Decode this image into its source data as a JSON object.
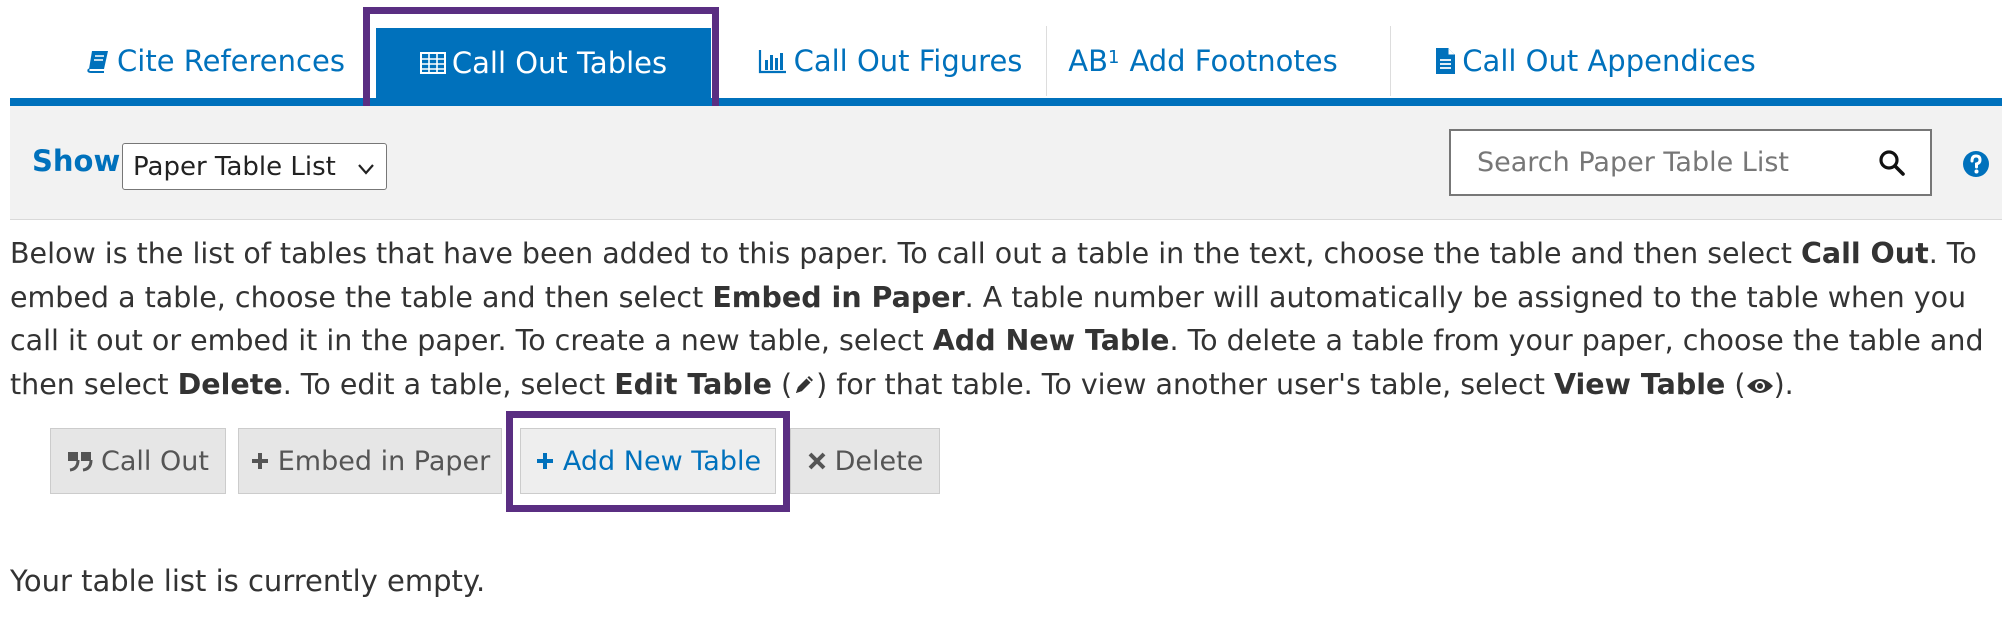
{
  "tabs": [
    {
      "label": "Cite References",
      "icon": "book-icon"
    },
    {
      "label": "Call Out Tables",
      "icon": "table-icon",
      "active": true
    },
    {
      "label": "Call Out Figures",
      "icon": "bar-chart-icon"
    },
    {
      "label": "Add Footnotes",
      "icon": "superscript-icon",
      "prefix": "AB",
      "sup": "1"
    },
    {
      "label": "Call Out Appendices",
      "icon": "document-icon"
    }
  ],
  "toolbar": {
    "show_label": "Show",
    "select_value": "Paper Table List",
    "search_placeholder": "Search Paper Table List"
  },
  "description": {
    "p1": "Below is the list of tables that have been added to this paper. To call out a table in the text, choose the table and then select ",
    "b1": "Call Out",
    "p2": ". To embed a table, choose the table and then select ",
    "b2": "Embed in Paper",
    "p3": ". A table number will automatically be assigned to the table when you call it out or embed it in the paper. To create a new table, select ",
    "b3": "Add New Table",
    "p4": ". To delete a table from your paper, choose the table and then select ",
    "b4": "Delete",
    "p5": ". To edit a table, select ",
    "b5": "Edit Table",
    "p6": " (",
    "p7": ") for that table. To view another user's table, select ",
    "b6": "View Table",
    "p8": " (",
    "p9": ")."
  },
  "actions": {
    "call_out": "Call Out",
    "embed": "Embed in Paper",
    "add_new": "Add New Table",
    "delete": "Delete"
  },
  "empty_message": "Your table list is currently empty.",
  "colors": {
    "accent": "#0071bc",
    "highlight": "#5a2e82",
    "toolbar_bg": "#f2f2f2"
  }
}
